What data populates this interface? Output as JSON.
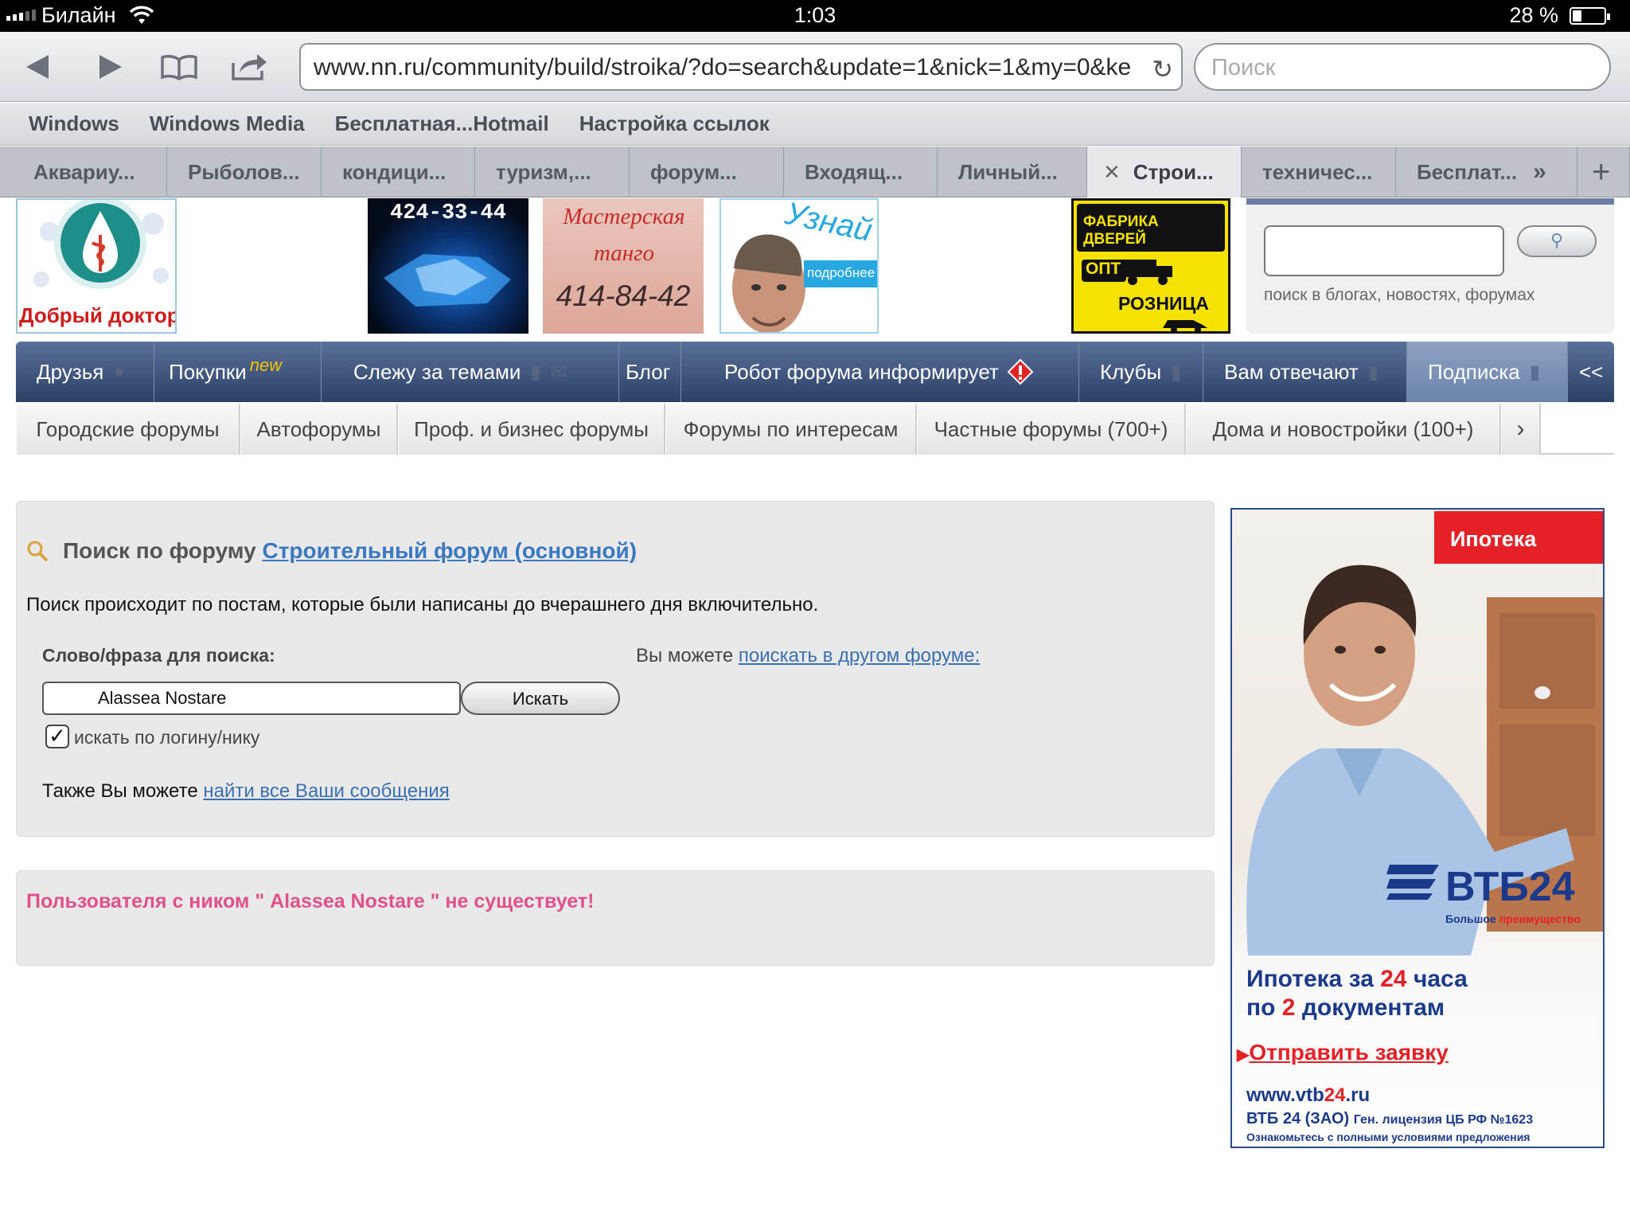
{
  "status": {
    "carrier": "Билайн",
    "time": "1:03",
    "battery": "28 %"
  },
  "browser": {
    "url": "www.nn.ru/community/build/stroika/?do=search&update=1&nick=1&my=0&ke",
    "search_placeholder": "Поиск",
    "bookmarks": [
      "Windows",
      "Windows Media",
      "Бесплатная...Hotmail",
      "Настройка ссылок"
    ],
    "tabs": [
      "Аквариу...",
      "Рыболов...",
      "кондици...",
      "туризм,...",
      "форум...",
      "Входящ...",
      "Личный...",
      "Строи...",
      "техничес...",
      "Бесплат..."
    ],
    "active_tab_index": 7
  },
  "ads": {
    "doctor": "Добрый доктор",
    "phone1": "424-33-44",
    "tango_title": "Мастерская танго",
    "tango_phone": "414-84-42",
    "uznai": "Узнай",
    "podrobnee": "подробнее",
    "bravo1": "ФАБРИКА",
    "bravo2": "ДВЕРЕЙ",
    "opt": "ОПТ",
    "roznica": "РОЗНИЦА"
  },
  "site_search": {
    "hint": "поиск в блогах, новостях, форумах"
  },
  "nav": {
    "items": [
      "Друзья",
      "Покупки",
      "Слежу за темами",
      "Блог",
      "Робот форума информирует",
      "Клубы",
      "Вам отвечают",
      "Подписка",
      "<<"
    ],
    "new_badge": "new",
    "sub": [
      "Городские форумы",
      "Автофорумы",
      "Проф. и бизнес форумы",
      "Форумы по интересам",
      "Частные форумы (700+)",
      "Дома и новостройки (100+)"
    ]
  },
  "search_panel": {
    "title": "Поиск по форуму",
    "forum_link": "Строительный форум (основной)",
    "info": "Поиск происходит по постам, которые были написаны до вчерашнего дня включительно.",
    "phrase_label": "Слово/фраза для поиска:",
    "other_prefix": "Вы можете",
    "other_link": "поискать в другом форуме:",
    "query": "Alassea Nostare",
    "button": "Искать",
    "nick_checkbox": "искать по логину/нику",
    "nick_checked": true,
    "also_prefix": "Также Вы можете",
    "also_link": "найти все Ваши сообщения"
  },
  "result": {
    "message": "Пользователя с ником \" Alassea Nostare \" не существует!"
  },
  "vtb_ad": {
    "badge": "Ипотека",
    "brand": "ВТБ24",
    "slogan_a": "Большое",
    "slogan_b": "преимущество",
    "line1_a": "Ипотека за",
    "line1_num": "24",
    "line1_b": "часа",
    "line2_a": "по",
    "line2_num": "2",
    "line2_b": "документам",
    "cta": "Отправить заявку",
    "site_a": "www.vtb",
    "site_num": "24",
    "site_b": ".ru",
    "legal1": "ВТБ 24 (ЗАО)",
    "legal2": "Ген. лицензия ЦБ РФ №1623",
    "legal3": "Ознакомьтесь с полными условиями предложения"
  },
  "colors": {
    "nav_dark": "#2d4166",
    "link": "#3a6fb2",
    "error": "#e0508a",
    "vtb_red": "#e52127",
    "vtb_blue": "#1b3a8c"
  }
}
